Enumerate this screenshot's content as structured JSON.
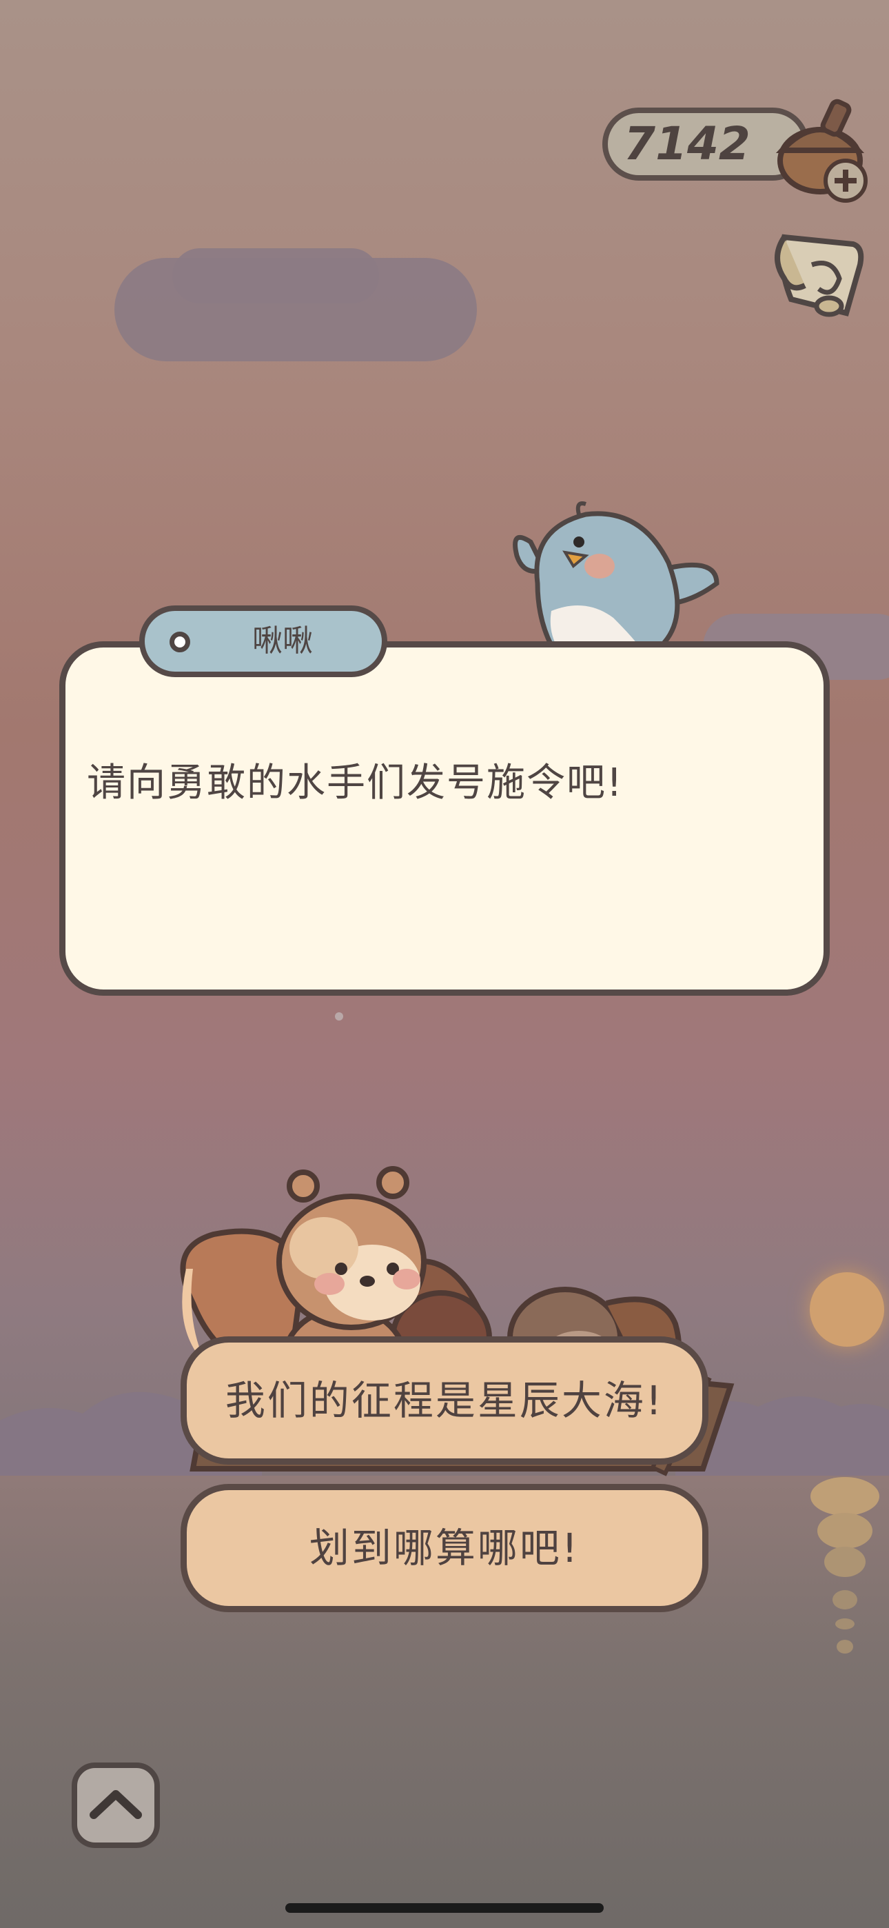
{
  "hud": {
    "acorn_count": "7142",
    "acorn_icon": "acorn-icon",
    "add_icon": "plus-icon",
    "map_icon": "scroll-map-icon"
  },
  "dialog": {
    "speaker": "啾啾",
    "text": "请向勇敢的水手们发号施令吧!"
  },
  "choices": [
    {
      "label": "我们的征程是星辰大海!"
    },
    {
      "label": "划到哪算哪吧!"
    }
  ],
  "controls": {
    "expand_icon": "chevron-up-icon"
  },
  "colors": {
    "accent": "#ebc7a2",
    "dialog_bg": "#fff8e7",
    "outline": "#564a48",
    "tab_bg": "#a9c2cb"
  }
}
